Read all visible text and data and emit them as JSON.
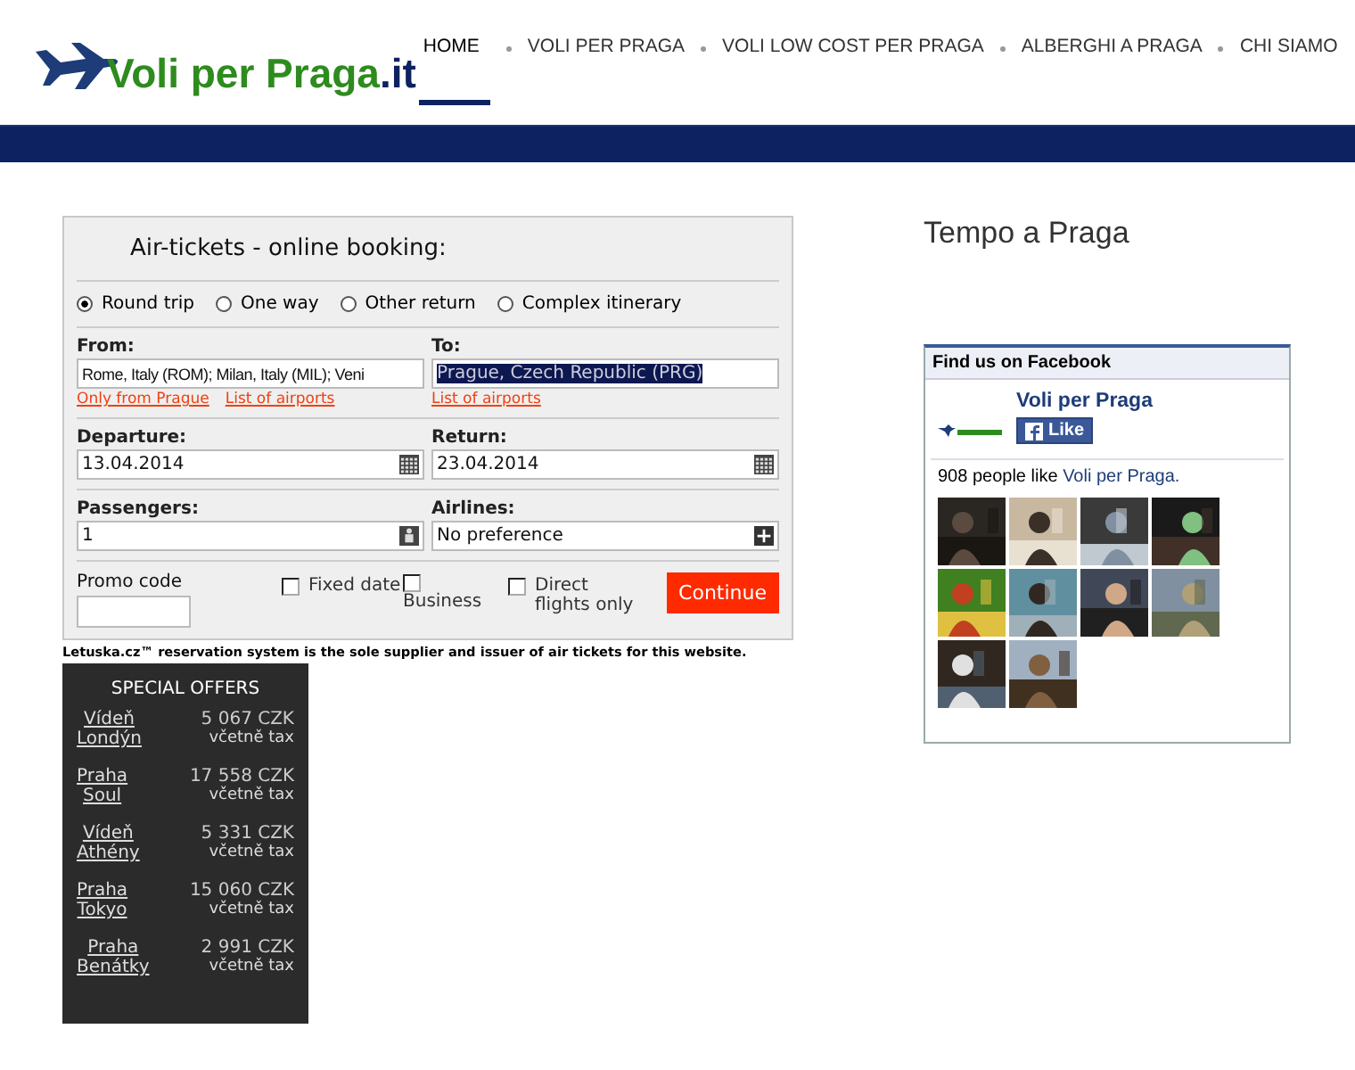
{
  "logo": {
    "text": "Voli per Praga",
    "suffix": ".it"
  },
  "nav": [
    {
      "label": "HOME",
      "selected": true
    },
    {
      "label": "VOLI PER PRAGA",
      "selected": false
    },
    {
      "label": "VOLI LOW COST PER PRAGA",
      "selected": false
    },
    {
      "label": "ALBERGHI A PRAGA",
      "selected": false
    },
    {
      "label": "CHI SIAMO",
      "selected": false
    }
  ],
  "booking": {
    "title": "Air-tickets - online booking:",
    "trip_types": [
      {
        "label": "Round trip",
        "selected": true
      },
      {
        "label": "One way",
        "selected": false
      },
      {
        "label": "Other return",
        "selected": false
      },
      {
        "label": "Complex itinerary",
        "selected": false
      }
    ],
    "from": {
      "label": "From:",
      "value": "Rome, Italy (ROM); Milan, Italy (MIL); Veni",
      "links": [
        "Only from Prague",
        "List of airports"
      ]
    },
    "to": {
      "label": "To:",
      "value": "Prague, Czech Republic (PRG)",
      "highlighted": true,
      "links": [
        "List of airports"
      ]
    },
    "departure": {
      "label": "Departure:",
      "value": "13.04.2014"
    },
    "return": {
      "label": "Return:",
      "value": "23.04.2014"
    },
    "passengers": {
      "label": "Passengers:",
      "value": "1"
    },
    "airlines": {
      "label": "Airlines:",
      "value": "No preference"
    },
    "promo": {
      "label": "Promo code"
    },
    "options": [
      {
        "label": "Fixed date",
        "checked": false
      },
      {
        "label": "Business",
        "checked": false
      },
      {
        "label": "Direct flights only",
        "checked": false
      }
    ],
    "submit": "Continue",
    "disclaimer": "Letuska.cz™  reservation system is the sole supplier and issuer of air tickets for this website."
  },
  "special_offers": {
    "title": "SPECIAL OFFERS",
    "items": [
      {
        "from": "Vídeň",
        "to": "Londýn",
        "price": "5 067 CZK",
        "note": "včetně tax"
      },
      {
        "from": "Praha",
        "to": "Soul",
        "price": "17 558 CZK",
        "note": "včetně tax"
      },
      {
        "from": "Vídeň",
        "to": "Athény",
        "price": "5 331 CZK",
        "note": "včetně tax"
      },
      {
        "from": "Praha",
        "to": "Tokyo",
        "price": "15 060 CZK",
        "note": "včetně tax"
      },
      {
        "from": "Praha",
        "to": "Benátky",
        "price": "2 991 CZK",
        "note": "včetně tax"
      }
    ]
  },
  "weather": {
    "title": "Tempo a Praga"
  },
  "facebook": {
    "header": "Find us on Facebook",
    "page_name": "Voli per Praga",
    "like_button": "Like",
    "likes_prefix": "908 people like ",
    "likes_link": "Voli per Praga."
  }
}
